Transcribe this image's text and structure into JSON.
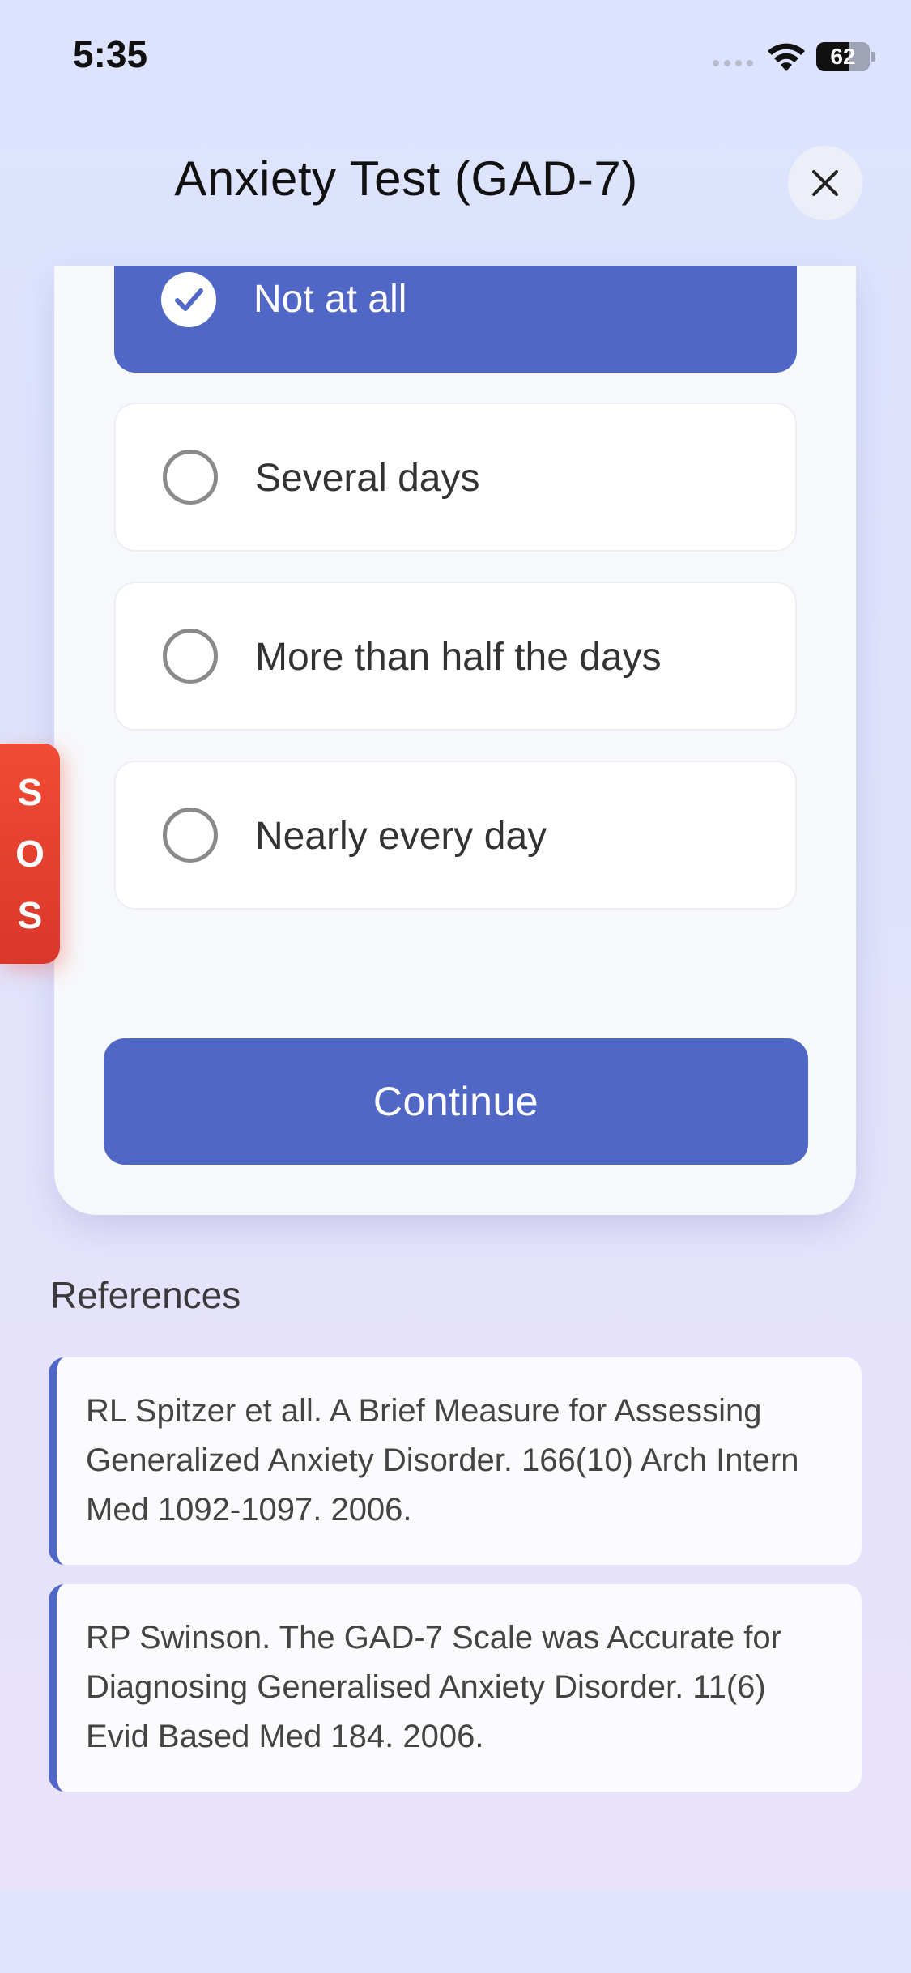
{
  "status_bar": {
    "time": "5:35",
    "battery": "62",
    "battery_level_percent": 62
  },
  "header": {
    "title": "Anxiety Test (GAD-7)"
  },
  "question": {
    "options": [
      {
        "label": "Not at all",
        "selected": true
      },
      {
        "label": "Several days",
        "selected": false
      },
      {
        "label": "More than half the days",
        "selected": false
      },
      {
        "label": "Nearly every day",
        "selected": false
      }
    ],
    "continue_label": "Continue"
  },
  "sos": {
    "letters": [
      "S",
      "O",
      "S"
    ]
  },
  "references": {
    "title": "References",
    "items": [
      "RL Spitzer et all. A Brief Measure for Assessing Generalized Anxiety Disorder. 166(10) Arch Intern Med 1092-1097. 2006.",
      "RP Swinson. The GAD-7 Scale was Accurate for Diagnosing Generalised Anxiety Disorder. 11(6) Evid Based Med 184. 2006."
    ]
  },
  "colors": {
    "accent": "#5167c5",
    "sos": "#e8412f"
  }
}
